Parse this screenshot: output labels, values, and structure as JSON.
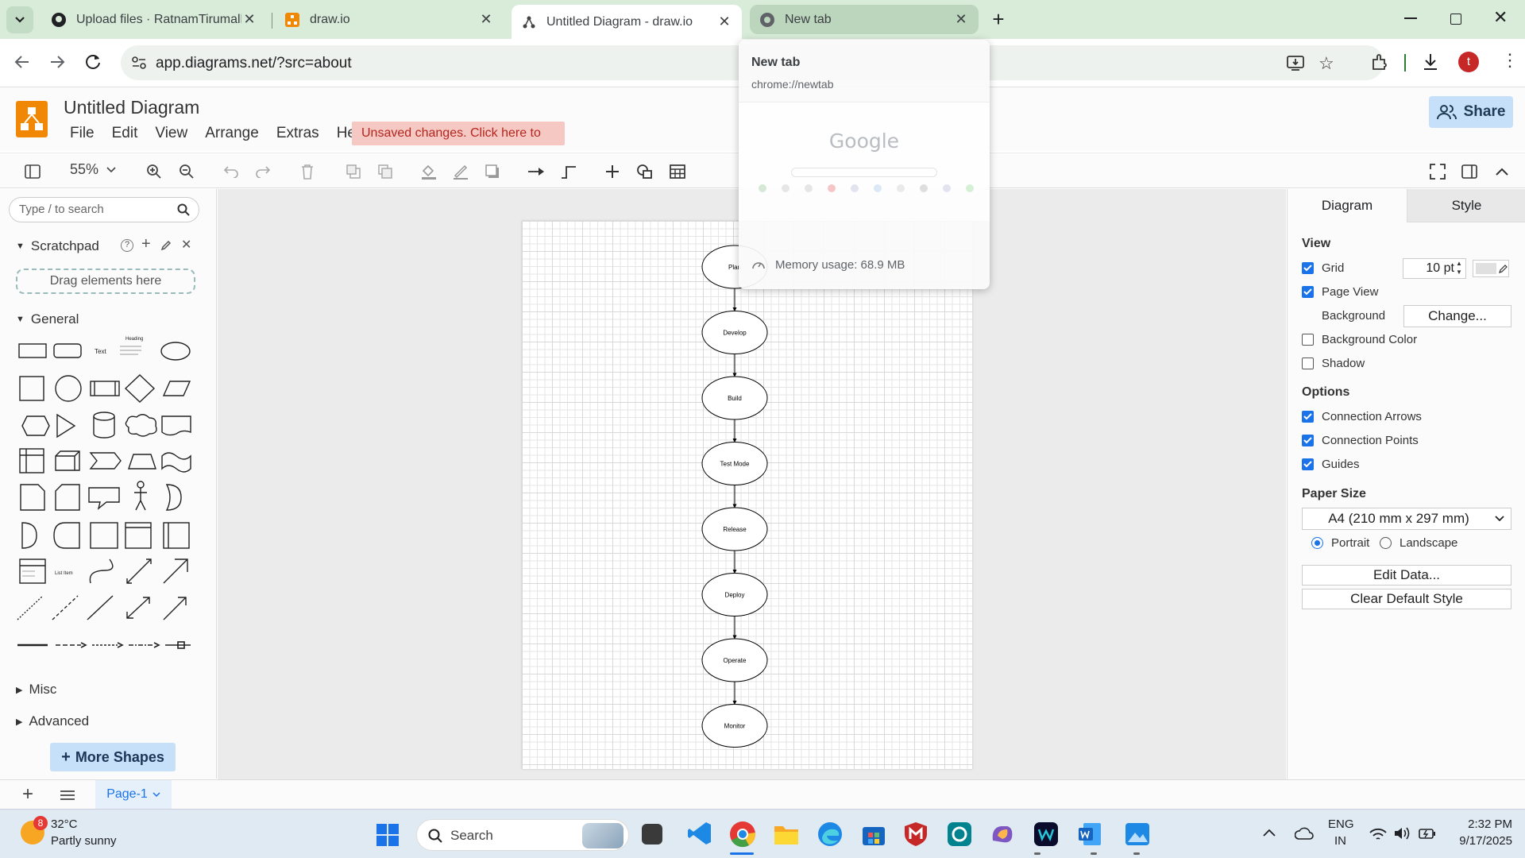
{
  "browser": {
    "tabs": [
      {
        "title": "Upload files · RatnamTirumalla/",
        "icon": "github-icon",
        "state": "normal"
      },
      {
        "title": "draw.io",
        "icon": "drawio-icon",
        "state": "normal"
      },
      {
        "title": "Untitled Diagram - draw.io",
        "icon": "drawio-page-icon",
        "state": "active"
      },
      {
        "title": "New tab",
        "icon": "chrome-icon",
        "state": "hover"
      }
    ],
    "url": "app.diagrams.net/?src=about",
    "profile_initial": "t"
  },
  "hovercard": {
    "title": "New tab",
    "url": "chrome://newtab",
    "preview_logo": "Google",
    "memory": "Memory usage: 68.9 MB"
  },
  "app": {
    "title": "Untitled Diagram",
    "menu": [
      "File",
      "Edit",
      "View",
      "Arrange",
      "Extras",
      "Help"
    ],
    "unsaved": "Unsaved changes. Click here to save.",
    "share": "Share",
    "zoom": "55%"
  },
  "sidebar": {
    "search_placeholder": "Type / to search",
    "scratchpad": "Scratchpad",
    "drag_here": "Drag elements here",
    "general": "General",
    "text_shape": "Text",
    "heading_shape": "Heading",
    "list_item_shape": "List Item",
    "misc": "Misc",
    "advanced": "Advanced",
    "more_shapes": "More Shapes"
  },
  "diagram": {
    "nodes": [
      "Plan",
      "Develop",
      "Build",
      "Test Mode",
      "Release",
      "Deploy",
      "Operate",
      "Monitor"
    ]
  },
  "format_panel": {
    "tabs": [
      "Diagram",
      "Style"
    ],
    "view_header": "View",
    "grid": {
      "label": "Grid",
      "checked": true,
      "size": "10 pt"
    },
    "page_view": {
      "label": "Page View",
      "checked": true
    },
    "background": {
      "label": "Background",
      "button": "Change..."
    },
    "background_color": {
      "label": "Background Color",
      "checked": false
    },
    "shadow": {
      "label": "Shadow",
      "checked": false
    },
    "options_header": "Options",
    "connection_arrows": {
      "label": "Connection Arrows",
      "checked": true
    },
    "connection_points": {
      "label": "Connection Points",
      "checked": true
    },
    "guides": {
      "label": "Guides",
      "checked": true
    },
    "paper_size_header": "Paper Size",
    "paper_size": "A4 (210 mm x 297 mm)",
    "portrait": "Portrait",
    "landscape": "Landscape",
    "edit_data": "Edit Data...",
    "clear_style": "Clear Default Style"
  },
  "pages": {
    "current": "Page-1"
  },
  "taskbar": {
    "weather_temp": "32°C",
    "weather_desc": "Partly sunny",
    "weather_badge": "8",
    "search": "Search",
    "lang1": "ENG",
    "lang2": "IN",
    "time": "2:32 PM",
    "date": "9/17/2025"
  },
  "colors": {
    "accent": "#1a73e8",
    "drawio_orange": "#f08705",
    "unsaved_bg": "#f6c8c4",
    "share_bg": "#c5e0f8"
  }
}
